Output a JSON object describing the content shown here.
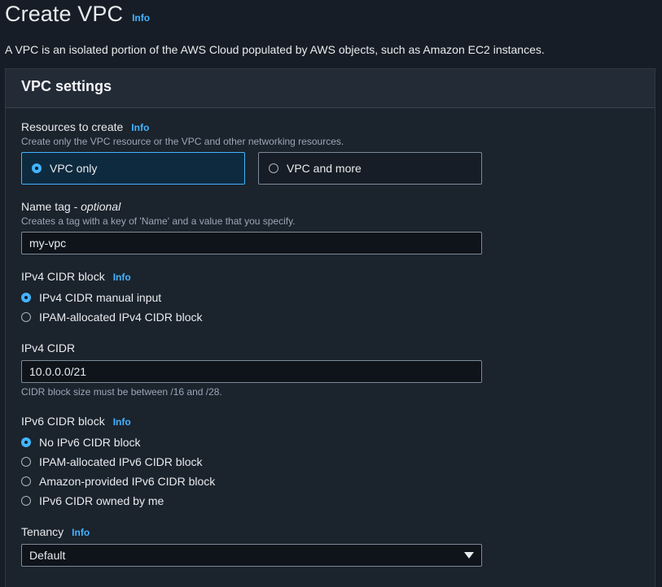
{
  "header": {
    "title": "Create VPC",
    "info": "Info",
    "description": "A VPC is an isolated portion of the AWS Cloud populated by AWS objects, such as Amazon EC2 instances."
  },
  "panel": {
    "title": "VPC settings"
  },
  "resources": {
    "label": "Resources to create",
    "info": "Info",
    "hint": "Create only the VPC resource or the VPC and other networking resources.",
    "options": [
      {
        "label": "VPC only",
        "selected": true
      },
      {
        "label": "VPC and more",
        "selected": false
      }
    ]
  },
  "name_tag": {
    "label": "Name tag - ",
    "label_optional": "optional",
    "hint": "Creates a tag with a key of 'Name' and a value that you specify.",
    "value": "my-vpc"
  },
  "ipv4_block": {
    "label": "IPv4 CIDR block",
    "info": "Info",
    "options": [
      {
        "label": "IPv4 CIDR manual input",
        "selected": true
      },
      {
        "label": "IPAM-allocated IPv4 CIDR block",
        "selected": false
      }
    ]
  },
  "ipv4_cidr": {
    "label": "IPv4 CIDR",
    "value": "10.0.0.0/21",
    "hint": "CIDR block size must be between /16 and /28."
  },
  "ipv6_block": {
    "label": "IPv6 CIDR block",
    "info": "Info",
    "options": [
      {
        "label": "No IPv6 CIDR block",
        "selected": true
      },
      {
        "label": "IPAM-allocated IPv6 CIDR block",
        "selected": false
      },
      {
        "label": "Amazon-provided IPv6 CIDR block",
        "selected": false
      },
      {
        "label": "IPv6 CIDR owned by me",
        "selected": false
      }
    ]
  },
  "tenancy": {
    "label": "Tenancy",
    "info": "Info",
    "selected": "Default"
  },
  "colors": {
    "accent": "#42b4ff",
    "background": "#161d26",
    "panel": "#1b232d"
  }
}
